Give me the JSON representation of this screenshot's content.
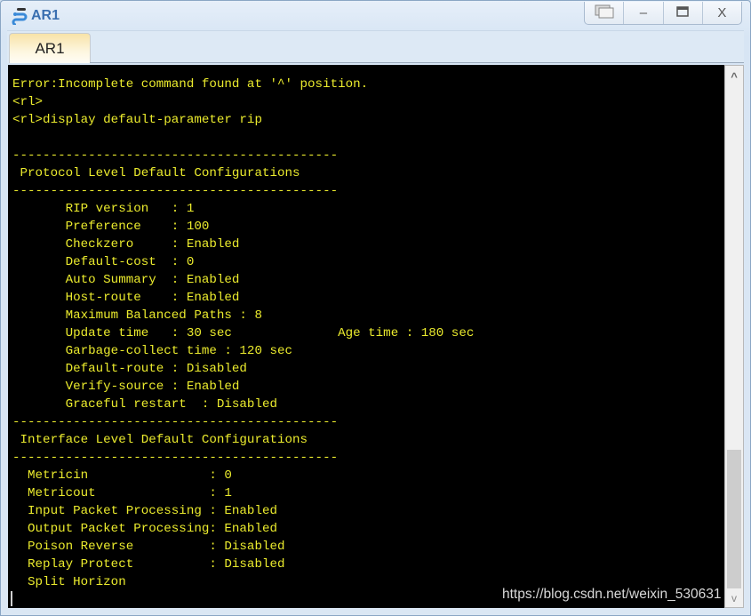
{
  "window": {
    "title": "AR1",
    "app_icon": "network-device-icon",
    "controls": {
      "restore_icon": "restore-windows-icon",
      "minimize_label": "–",
      "maximize_icon": "maximize-icon",
      "close_label": "X"
    }
  },
  "tabs": [
    {
      "label": "AR1",
      "active": true
    }
  ],
  "terminal": {
    "colors": {
      "background": "#000000",
      "text": "#ebeb2d"
    },
    "lines": [
      "Error:Incomplete command found at '^' position.",
      "<rl>",
      "<rl>display default-parameter rip",
      "",
      "-------------------------------------------",
      " Protocol Level Default Configurations",
      "-------------------------------------------",
      "       RIP version   : 1",
      "       Preference    : 100",
      "       Checkzero     : Enabled",
      "       Default-cost  : 0",
      "       Auto Summary  : Enabled",
      "       Host-route    : Enabled",
      "       Maximum Balanced Paths : 8",
      "       Update time   : 30 sec              Age time : 180 sec",
      "       Garbage-collect time : 120 sec",
      "       Default-route : Disabled",
      "       Verify-source : Enabled",
      "       Graceful restart  : Disabled",
      "-------------------------------------------",
      " Interface Level Default Configurations",
      "-------------------------------------------",
      "  Metricin                : 0",
      "  Metricout               : 1",
      "  Input Packet Processing : Enabled",
      "  Output Packet Processing: Enabled",
      "  Poison Reverse          : Disabled",
      "  Replay Protect          : Disabled",
      "  Split Horizon"
    ]
  },
  "watermark": "https://blog.csdn.net/weixin_530631",
  "scrollbar": {
    "up_glyph": "^",
    "down_glyph": "v",
    "position_fraction": 1.0
  }
}
